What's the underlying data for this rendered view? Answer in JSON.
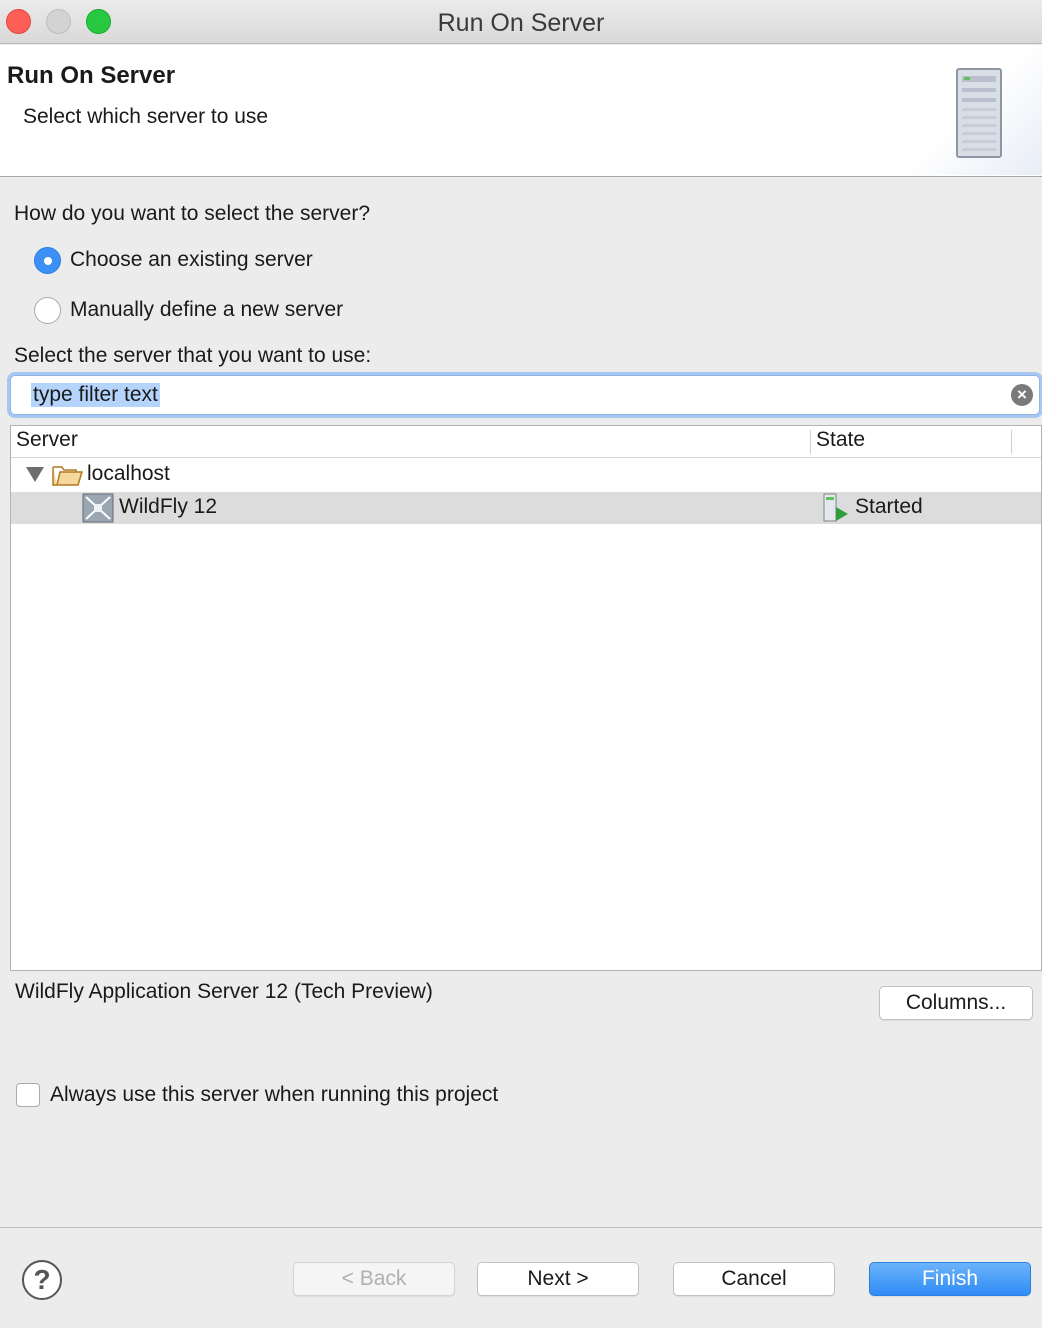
{
  "window": {
    "title": "Run On Server"
  },
  "banner": {
    "title": "Run On Server",
    "subtitle": "Select which server to use",
    "icon": "server-icon"
  },
  "selection": {
    "question": "How do you want to select the server?",
    "options": [
      {
        "label": "Choose an existing server",
        "selected": true
      },
      {
        "label": "Manually define a new server",
        "selected": false
      }
    ],
    "select_label": "Select the server that you want to use:"
  },
  "filter": {
    "value": "type filter text"
  },
  "table": {
    "columns": [
      "Server",
      "State"
    ],
    "host": {
      "label": "localhost",
      "expanded": true
    },
    "servers": [
      {
        "name": "WildFly 12",
        "state": "Started",
        "selected": true
      }
    ]
  },
  "description": "WildFly Application Server 12 (Tech Preview)",
  "buttons": {
    "columns": "Columns...",
    "back": "< Back",
    "next": "Next >",
    "cancel": "Cancel",
    "finish": "Finish"
  },
  "always_use": {
    "label": "Always use this server when running this project",
    "checked": false
  },
  "colors": {
    "accent": "#3d90f5",
    "selection_row": "#dcdcdc"
  }
}
